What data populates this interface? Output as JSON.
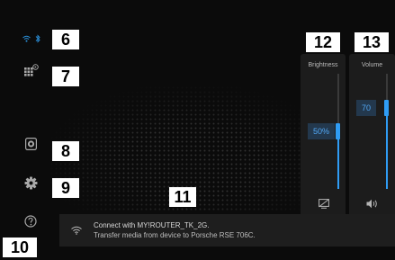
{
  "status_bar": {
    "icons": [
      "wifi-icon",
      "bluetooth-icon"
    ],
    "color": "#2a8fd8"
  },
  "left_menu": {
    "icons": [
      "apps-grid-icon",
      "speaker-icon",
      "settings-gear-icon",
      "help-icon"
    ]
  },
  "callouts": [
    "6",
    "7",
    "8",
    "9",
    "10",
    "11",
    "12",
    "13"
  ],
  "brightness": {
    "title": "Brightness",
    "value_label": "50%",
    "level": 0.5,
    "icon": "display-off-icon"
  },
  "volume": {
    "title": "Volume",
    "value_label": "70",
    "level": 0.7,
    "icon": "volume-icon"
  },
  "notification": {
    "icon": "wifi-icon",
    "line1": "Connect with MY!ROUTER_TK_2G.",
    "line2": "Transfer media from device to Porsche RSE 706C."
  },
  "colors": {
    "accent": "#2f9cf4",
    "panel": "#1c1c1c",
    "background": "#0b0b0b"
  }
}
